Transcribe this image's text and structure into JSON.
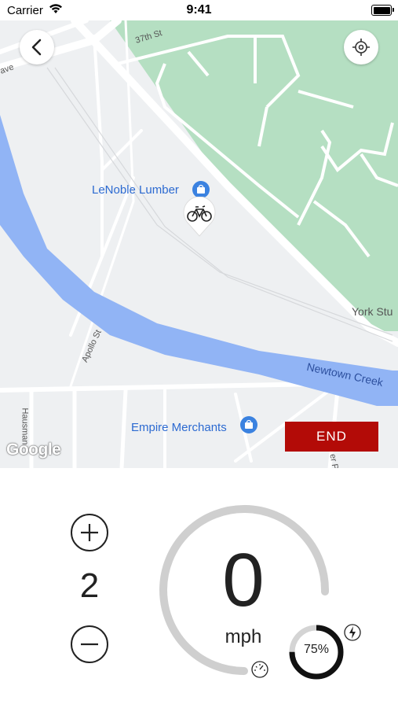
{
  "status_bar": {
    "carrier": "Carrier",
    "time": "9:41"
  },
  "map": {
    "pois": [
      {
        "label": "LeNoble Lumber"
      },
      {
        "label": "Empire Merchants"
      }
    ],
    "streets": {
      "s37": "37th St",
      "ave": "ave",
      "apollo": "Apollo St",
      "york": "York Stu",
      "hausman": "Hausman",
      "partial": "er P"
    },
    "water_label": "Newtown Creek",
    "attribution": "Google",
    "colors": {
      "park": "#b5dfc2",
      "water": "#91b4f5",
      "land": "#eef0f2",
      "road": "#ffffff"
    }
  },
  "controls": {
    "end_label": "END",
    "assist_level": "2",
    "speed": "0",
    "speed_unit": "mph",
    "battery_percent_label": "75%",
    "battery_fraction": 0.75
  },
  "icons": [
    "chevron-left-icon",
    "locate-icon",
    "bicycle-icon",
    "shopping-bag-icon",
    "plus-icon",
    "minus-icon",
    "speedometer-icon",
    "charging-bolt-icon"
  ],
  "accent_color": "#b30b07"
}
